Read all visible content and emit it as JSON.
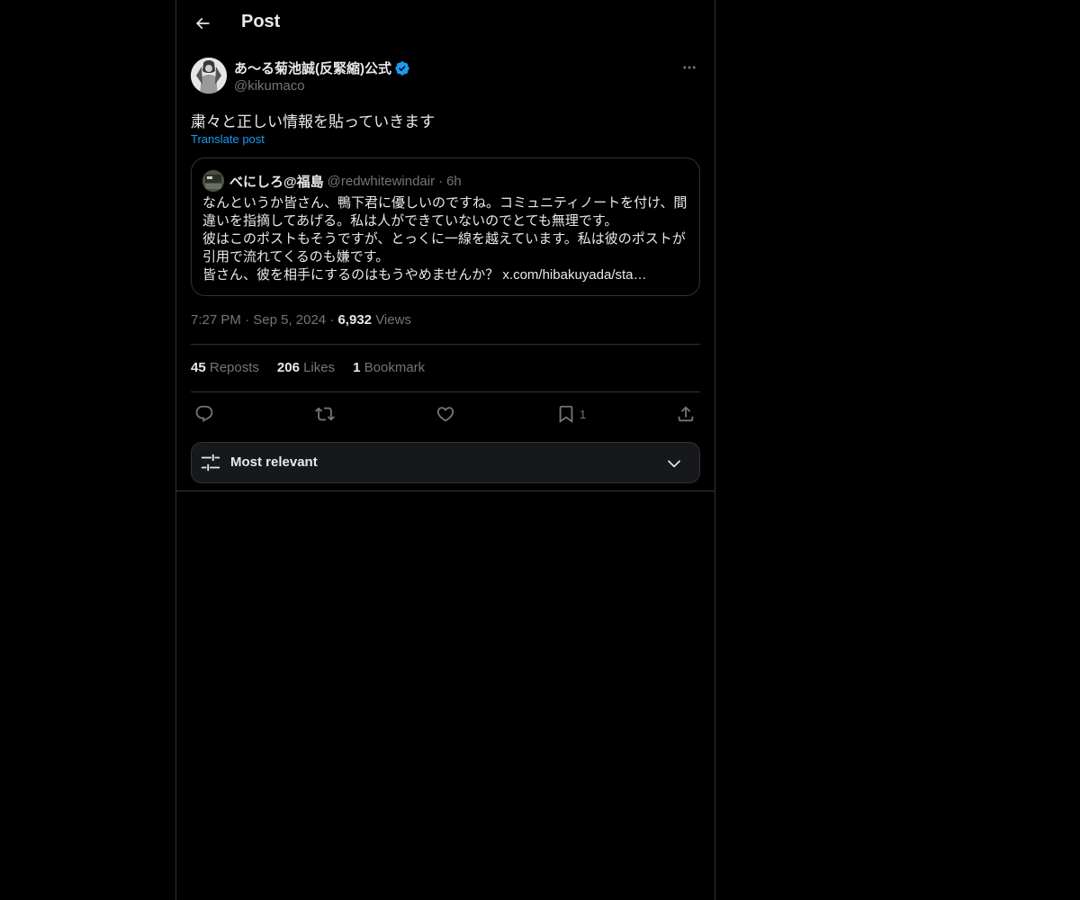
{
  "header": {
    "title": "Post"
  },
  "post": {
    "author_name": "あ〜る菊池誠(反緊縮)公式",
    "author_handle": "@kikumaco",
    "text": "粛々と正しい情報を貼っていきます",
    "translate_label": "Translate post",
    "quote": {
      "name": "べにしろ@福島",
      "handle": "@redwhitewindair",
      "separator": "·",
      "time": "6h",
      "lines": [
        "なんというか皆さん、鴨下君に優しいのですね。コミュニティノートを付け、間",
        "違いを指摘してあげる。私は人ができていないのでとても無理です。",
        "彼はこのポストもそうですが、とっくに一線を越えています。私は彼のポストが",
        "引用で流れてくるのも嫌です。",
        "皆さん、彼を相手にするのはもうやめませんか？ x.com/hibakuyada/sta…"
      ]
    },
    "time": "7:27 PM",
    "date": "Sep 5, 2024",
    "meta_separator": "·",
    "views_count": "6,932",
    "views_label": "Views",
    "stats": {
      "reposts_count": "45",
      "reposts_label": "Reposts",
      "likes_count": "206",
      "likes_label": "Likes",
      "bookmarks_count": "1",
      "bookmarks_label": "Bookmark"
    },
    "actions": {
      "bookmark_count": "1"
    }
  },
  "sort": {
    "label": "Most relevant"
  },
  "colors": {
    "background": "#000000",
    "text": "#e7e9ea",
    "secondary": "#71767b",
    "accent": "#1d9bf0",
    "border": "#2f3336"
  },
  "icons": {
    "back": "arrow-left-icon",
    "verified": "verified-badge-icon",
    "more": "more-dots-icon",
    "reply": "reply-icon",
    "repost": "repost-icon",
    "like": "heart-icon",
    "bookmark": "bookmark-icon",
    "share": "share-icon",
    "sort": "sliders-icon",
    "chevron": "chevron-down-icon"
  }
}
